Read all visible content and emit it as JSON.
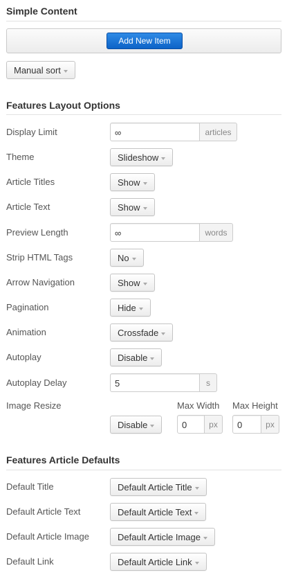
{
  "simple_content": {
    "title": "Simple Content",
    "add_button": "Add New Item",
    "sort_label": "Manual sort"
  },
  "layout_options": {
    "title": "Features Layout Options",
    "display_limit": {
      "label": "Display Limit",
      "value": "∞",
      "unit": "articles"
    },
    "theme": {
      "label": "Theme",
      "value": "Slideshow"
    },
    "article_titles": {
      "label": "Article Titles",
      "value": "Show"
    },
    "article_text": {
      "label": "Article Text",
      "value": "Show"
    },
    "preview_length": {
      "label": "Preview Length",
      "value": "∞",
      "unit": "words"
    },
    "strip_html": {
      "label": "Strip HTML Tags",
      "value": "No"
    },
    "arrow_navigation": {
      "label": "Arrow Navigation",
      "value": "Show"
    },
    "pagination": {
      "label": "Pagination",
      "value": "Hide"
    },
    "animation": {
      "label": "Animation",
      "value": "Crossfade"
    },
    "autoplay": {
      "label": "Autoplay",
      "value": "Disable"
    },
    "autoplay_delay": {
      "label": "Autoplay Delay",
      "value": "5",
      "unit": "s"
    },
    "image_resize": {
      "label": "Image Resize",
      "value": "Disable",
      "max_width_label": "Max Width",
      "max_width_value": "0",
      "max_height_label": "Max Height",
      "max_height_value": "0",
      "unit": "px"
    }
  },
  "article_defaults": {
    "title": "Features Article Defaults",
    "default_title": {
      "label": "Default Title",
      "value": "Default Article Title"
    },
    "default_text": {
      "label": "Default Article Text",
      "value": "Default Article Text"
    },
    "default_image": {
      "label": "Default Article Image",
      "value": "Default Article Image"
    },
    "default_link": {
      "label": "Default Link",
      "value": "Default Article Link"
    }
  },
  "colors": {
    "primary_button": "#1166cc",
    "text": "#333333",
    "label": "#555555"
  },
  "icons": {
    "dropdown": "caret-down-icon"
  }
}
